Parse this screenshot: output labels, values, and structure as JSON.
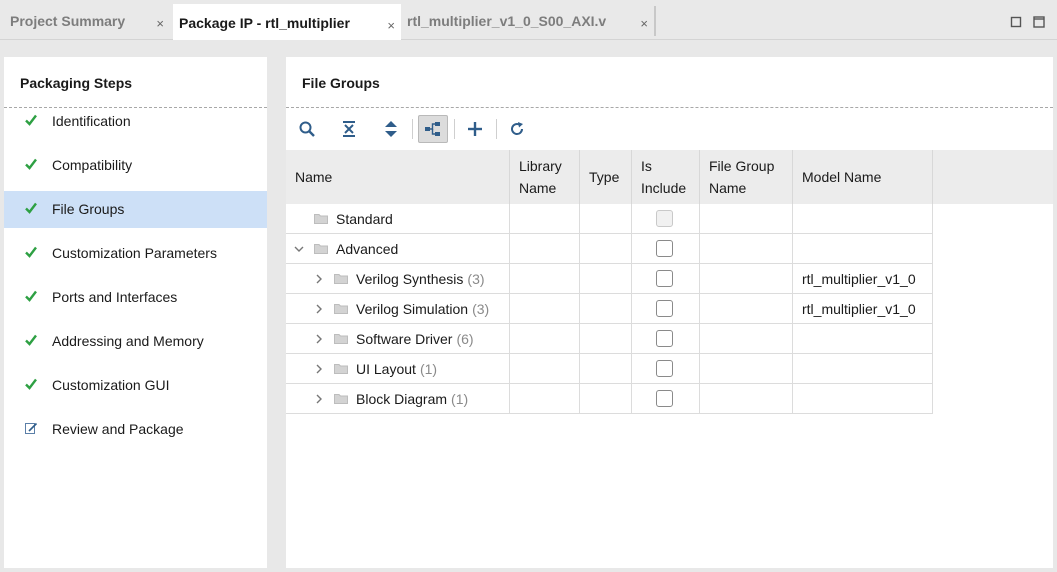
{
  "tabs": [
    {
      "label": "Project Summary",
      "active": false
    },
    {
      "label": "Package IP - rtl_multiplier",
      "active": true
    },
    {
      "label": "rtl_multiplier_v1_0_S00_AXI.v",
      "active": false
    }
  ],
  "tab_close_glyph": "×",
  "left": {
    "title": "Packaging Steps",
    "steps": [
      {
        "label": "Identification",
        "icon": "check-icon",
        "selected": false
      },
      {
        "label": "Compatibility",
        "icon": "check-icon",
        "selected": false
      },
      {
        "label": "File Groups",
        "icon": "check-icon",
        "selected": true
      },
      {
        "label": "Customization Parameters",
        "icon": "check-icon",
        "selected": false
      },
      {
        "label": "Ports and Interfaces",
        "icon": "check-icon",
        "selected": false
      },
      {
        "label": "Addressing and Memory",
        "icon": "check-icon",
        "selected": false
      },
      {
        "label": "Customization GUI",
        "icon": "check-icon",
        "selected": false
      },
      {
        "label": "Review and Package",
        "icon": "edit-icon",
        "selected": false
      }
    ]
  },
  "right": {
    "title": "File Groups",
    "toolbar": [
      "search-icon",
      "collapse-all-icon",
      "expand-all-icon",
      "hierarchy-icon",
      "add-icon",
      "refresh-icon"
    ],
    "columns": [
      "Name",
      "Library Name",
      "Type",
      "Is Include",
      "File Group Name",
      "Model Name"
    ],
    "rows": [
      {
        "name": "Standard",
        "count": "",
        "level": 0,
        "expander": "none",
        "include_disabled": true,
        "model": ""
      },
      {
        "name": "Advanced",
        "count": "",
        "level": 0,
        "expander": "expanded",
        "include_disabled": false,
        "model": ""
      },
      {
        "name": "Verilog Synthesis",
        "count": "(3)",
        "level": 1,
        "expander": "collapsed",
        "include_disabled": false,
        "model": "rtl_multiplier_v1_0"
      },
      {
        "name": "Verilog Simulation",
        "count": "(3)",
        "level": 1,
        "expander": "collapsed",
        "include_disabled": false,
        "model": "rtl_multiplier_v1_0"
      },
      {
        "name": "Software Driver",
        "count": "(6)",
        "level": 1,
        "expander": "collapsed",
        "include_disabled": false,
        "model": ""
      },
      {
        "name": "UI Layout",
        "count": "(1)",
        "level": 1,
        "expander": "collapsed",
        "include_disabled": false,
        "model": ""
      },
      {
        "name": "Block Diagram",
        "count": "(1)",
        "level": 1,
        "expander": "collapsed",
        "include_disabled": false,
        "model": ""
      }
    ]
  },
  "colors": {
    "accent_check": "#2ea043",
    "selection": "#cde0f7",
    "toolbar_icon": "#2f5d8a"
  }
}
